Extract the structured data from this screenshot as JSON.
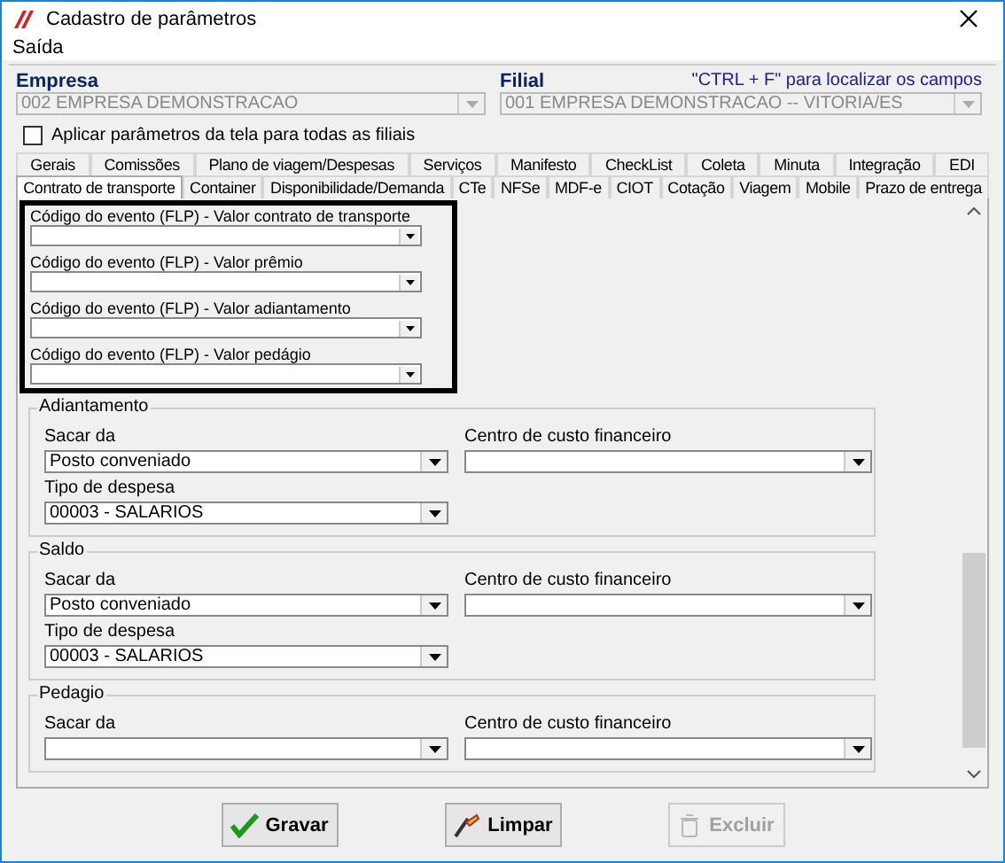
{
  "window": {
    "title": "Cadastro de parâmetros"
  },
  "menu": [
    {
      "label": "Saída"
    }
  ],
  "empresa": {
    "label": "Empresa",
    "value": "002 EMPRESA DEMONSTRACAO"
  },
  "filial": {
    "label": "Filial",
    "value": "001 EMPRESA DEMONSTRACAO -- VITORIA/ES"
  },
  "hint": "\"CTRL + F\" para localizar os campos",
  "apply_all": {
    "label": "Aplicar parâmetros da tela para todas as filiais",
    "checked": false
  },
  "tabs_row1": [
    {
      "label": "Gerais",
      "selected": false
    },
    {
      "label": "Comissões",
      "selected": false
    },
    {
      "label": "Plano de viagem/Despesas",
      "selected": false
    },
    {
      "label": "Serviços",
      "selected": false
    },
    {
      "label": "Manifesto",
      "selected": false
    },
    {
      "label": "CheckList",
      "selected": false
    },
    {
      "label": "Coleta",
      "selected": false
    },
    {
      "label": "Minuta",
      "selected": false
    },
    {
      "label": "Integração",
      "selected": false
    },
    {
      "label": "EDI",
      "selected": false
    }
  ],
  "tabs_row2": [
    {
      "label": "Contrato de transporte",
      "selected": true
    },
    {
      "label": "Container",
      "selected": false
    },
    {
      "label": "Disponibilidade/Demanda",
      "selected": false
    },
    {
      "label": "CTe",
      "selected": false
    },
    {
      "label": "NFSe",
      "selected": false
    },
    {
      "label": "MDF-e",
      "selected": false
    },
    {
      "label": "CIOT",
      "selected": false
    },
    {
      "label": "Cotação",
      "selected": false
    },
    {
      "label": "Viagem",
      "selected": false
    },
    {
      "label": "Mobile",
      "selected": false
    },
    {
      "label": "Prazo de entrega",
      "selected": false
    }
  ],
  "highlighted_fields": [
    {
      "label": "Código do evento (FLP) - Valor contrato de transporte"
    },
    {
      "label": "Código do evento (FLP) - Valor prêmio"
    },
    {
      "label": "Código do evento (FLP) - Valor adiantamento"
    },
    {
      "label": "Código do evento (FLP) - Valor pedágio"
    }
  ],
  "sections": [
    {
      "title": "Adiantamento",
      "fields": [
        {
          "label": "Sacar da",
          "value": "Posto conveniado"
        },
        {
          "label": "Centro de custo financeiro"
        },
        {
          "label": "Tipo de despesa",
          "value": "00003 - SALARIOS"
        }
      ]
    },
    {
      "title": "Saldo",
      "fields": [
        {
          "label": "Sacar da",
          "value": "Posto conveniado"
        },
        {
          "label": "Centro de custo financeiro"
        },
        {
          "label": "Tipo de despesa",
          "value": "00003 - SALARIOS"
        }
      ]
    },
    {
      "title": "Pedagio",
      "fields": [
        {
          "label": "Sacar da"
        },
        {
          "label": "Centro de custo financeiro"
        }
      ]
    }
  ],
  "buttons": [
    {
      "label": "Gravar",
      "kind": "save",
      "disabled": false
    },
    {
      "label": "Limpar",
      "kind": "clear",
      "disabled": false
    },
    {
      "label": "Excluir",
      "kind": "delete",
      "disabled": true
    }
  ]
}
